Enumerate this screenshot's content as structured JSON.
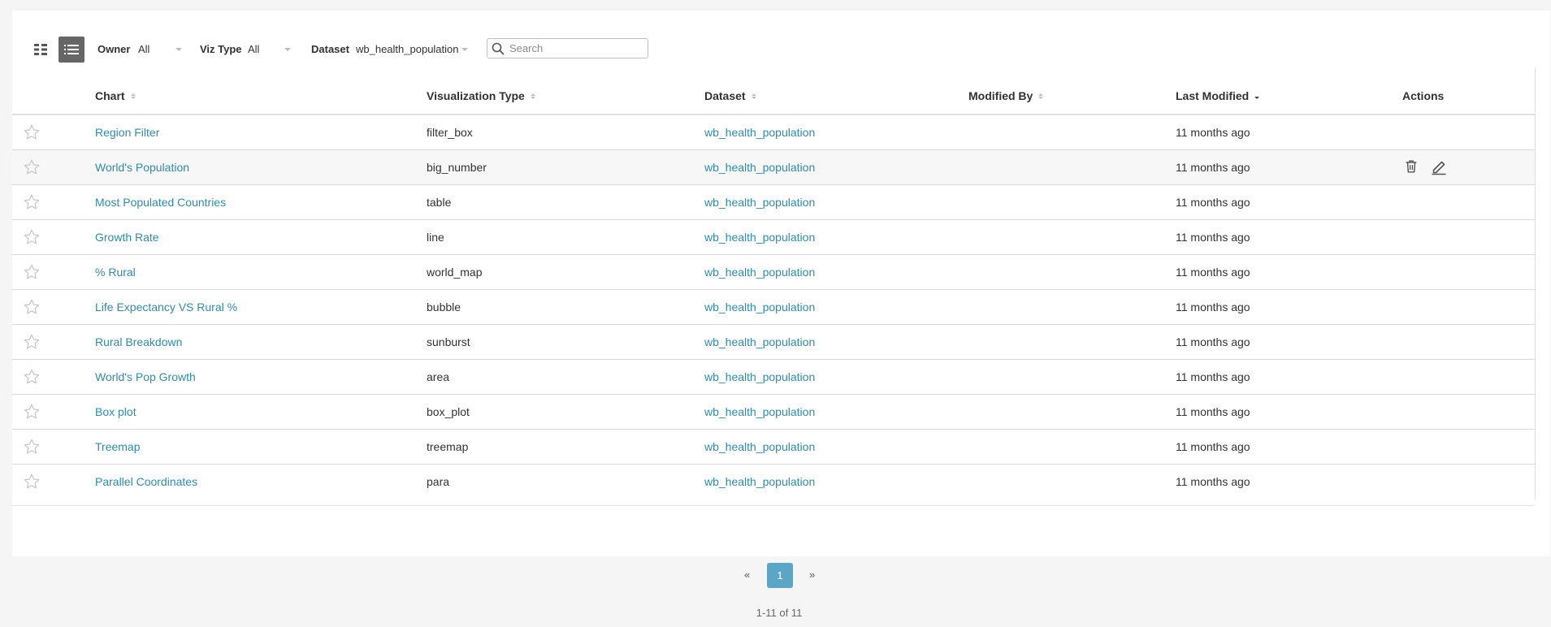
{
  "toolbar": {
    "owner_label": "Owner",
    "owner_value": "All",
    "viztype_label": "Viz Type",
    "viztype_value": "All",
    "dataset_label": "Dataset",
    "dataset_value": "wb_health_population",
    "search_placeholder": "Search",
    "search_value": ""
  },
  "table": {
    "columns": [
      "Chart",
      "Visualization Type",
      "Dataset",
      "Modified By",
      "Last Modified",
      "Actions"
    ],
    "sorted_column": "Last Modified",
    "rows": [
      {
        "chart": "Region Filter",
        "viz": "filter_box",
        "dataset": "wb_health_population",
        "modified_by": "",
        "last_modified": "11 months ago"
      },
      {
        "chart": "World's Population",
        "viz": "big_number",
        "dataset": "wb_health_population",
        "modified_by": "",
        "last_modified": "11 months ago"
      },
      {
        "chart": "Most Populated Countries",
        "viz": "table",
        "dataset": "wb_health_population",
        "modified_by": "",
        "last_modified": "11 months ago"
      },
      {
        "chart": "Growth Rate",
        "viz": "line",
        "dataset": "wb_health_population",
        "modified_by": "",
        "last_modified": "11 months ago"
      },
      {
        "chart": "% Rural",
        "viz": "world_map",
        "dataset": "wb_health_population",
        "modified_by": "",
        "last_modified": "11 months ago"
      },
      {
        "chart": "Life Expectancy VS Rural %",
        "viz": "bubble",
        "dataset": "wb_health_population",
        "modified_by": "",
        "last_modified": "11 months ago"
      },
      {
        "chart": "Rural Breakdown",
        "viz": "sunburst",
        "dataset": "wb_health_population",
        "modified_by": "",
        "last_modified": "11 months ago"
      },
      {
        "chart": "World's Pop Growth",
        "viz": "area",
        "dataset": "wb_health_population",
        "modified_by": "",
        "last_modified": "11 months ago"
      },
      {
        "chart": "Box plot",
        "viz": "box_plot",
        "dataset": "wb_health_population",
        "modified_by": "",
        "last_modified": "11 months ago"
      },
      {
        "chart": "Treemap",
        "viz": "treemap",
        "dataset": "wb_health_population",
        "modified_by": "",
        "last_modified": "11 months ago"
      },
      {
        "chart": "Parallel Coordinates",
        "viz": "para",
        "dataset": "wb_health_population",
        "modified_by": "",
        "last_modified": "11 months ago"
      }
    ]
  },
  "pagination": {
    "prev": "«",
    "current": "1",
    "next": "»",
    "range_text": "1-11 of 11"
  },
  "colors": {
    "link": "#2f8cac",
    "active_page": "#5ba6c6",
    "active_view_button": "#666666"
  },
  "icons": {
    "card_view": "grid-icon",
    "list_view": "list-icon",
    "search": "search-icon",
    "favorite": "star-icon",
    "delete": "trash-icon",
    "edit": "pencil-icon"
  }
}
